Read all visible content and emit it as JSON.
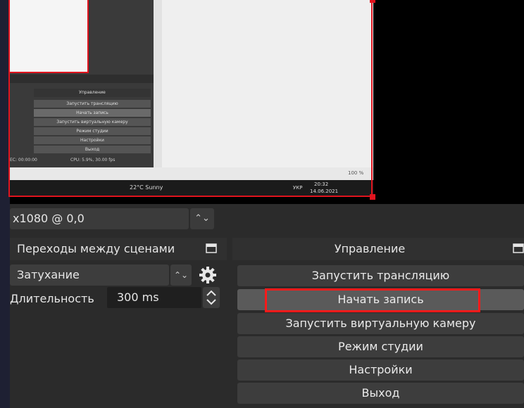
{
  "preview": {
    "inner": {
      "panel_title": "Управление",
      "buttons": [
        "Запустить трансляцию",
        "Начать запись",
        "Запустить виртуальную камеру",
        "Режим студии",
        "Настройки",
        "Выход"
      ],
      "status_left": "EC: 00:00:00",
      "status_cpu": "CPU: 5.9%, 30.00 fps",
      "zoom": "100 %"
    },
    "taskbar": {
      "weather": "22°C Sunny",
      "lang": "УКР",
      "time": "20:32",
      "date": "14.06.2021"
    }
  },
  "source_bar": {
    "resolution": "x1080 @ 0,0",
    "spin_icon": "updown-arrows-icon"
  },
  "transitions": {
    "title": "Переходы между сценами",
    "transition": "Затухание",
    "duration_label": "Длительность",
    "duration_value": "300 ms"
  },
  "controls": {
    "title": "Управление",
    "buttons": {
      "stream": "Запустить трансляцию",
      "record": "Начать запись",
      "virtual_cam": "Запустить виртуальную камеру",
      "studio": "Режим студии",
      "settings": "Настройки",
      "exit": "Выход"
    }
  },
  "colors": {
    "highlight": "#ff1a1a",
    "panel": "#2b2b2b",
    "button": "#3d3d3d",
    "background": "#1e2033"
  }
}
